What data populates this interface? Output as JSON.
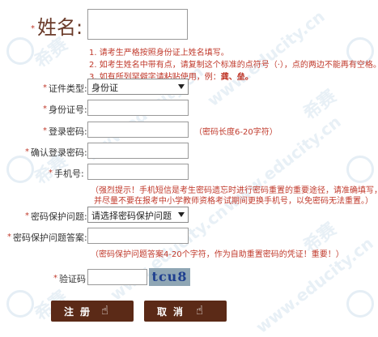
{
  "name_section": {
    "label": "姓名:",
    "rules": [
      "1. 请考生严格按照身份证上姓名填写。",
      "2. 如考生姓名中带有点，请复制这个标准的点符号（·），点的两边不能再有空格。",
      "3. 如有所列罕僻字请粘贴使用，例："
    ],
    "rule_examples": "龚、垒。"
  },
  "form": {
    "id_type": {
      "label": "证件类型:",
      "value": "身份证"
    },
    "id_number": {
      "label": "身份证号:",
      "value": ""
    },
    "password": {
      "label": "登录密码:",
      "value": "",
      "hint": "（密码长度6-20字符）"
    },
    "confirm_password": {
      "label": "确认登录密码:",
      "value": ""
    },
    "phone": {
      "label": "手机号:",
      "value": "",
      "notice_line1": "（强烈提示！手机短信是考生密码遗忘时进行密码重置的重要途径，请准确填写，",
      "notice_line2": "并尽量不要在报考中小学教师资格考试期间更换手机号，以免密码无法重置。）"
    },
    "security_question": {
      "label": "密码保护问题:",
      "value": "请选择密码保护问题"
    },
    "security_answer": {
      "label": "密码保护问题答案:",
      "value": "",
      "hint": "（密码保护问题答案4-20个字符，作为自助重置密码的凭证！重要！）"
    },
    "captcha": {
      "label": "验证码",
      "value": "",
      "image_text": "tcu8"
    },
    "required_mark": "*"
  },
  "buttons": {
    "register": "注册",
    "cancel": "取消"
  },
  "watermark": {
    "site": "www.educity.cn",
    "brand": "希赛"
  },
  "colors": {
    "label_red": "#c0392b",
    "button_bg": "#5b2a17",
    "captcha_bg": "#8fa6b4",
    "captcha_text": "#1f3f8f"
  }
}
